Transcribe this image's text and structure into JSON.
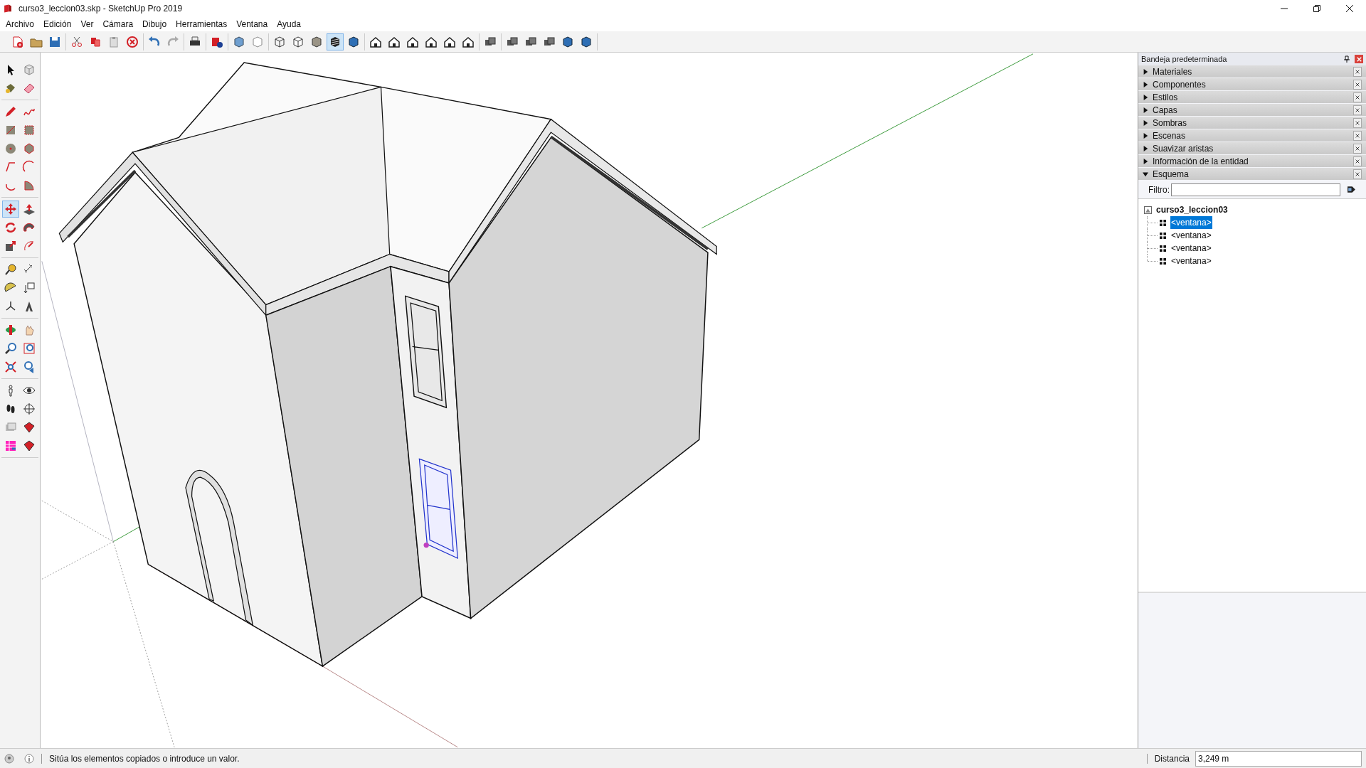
{
  "window": {
    "title": "curso3_leccion03.skp - SketchUp Pro 2019"
  },
  "menu": [
    "Archivo",
    "Edición",
    "Ver",
    "Cámara",
    "Dibujo",
    "Herramientas",
    "Ventana",
    "Ayuda"
  ],
  "toolbar": [
    [
      {
        "selected": false
      },
      {
        "selected": false
      },
      {
        "selected": false
      }
    ],
    [
      {
        "selected": false
      },
      {
        "selected": false
      },
      {
        "selected": false
      },
      {
        "selected": false
      }
    ],
    [
      {
        "selected": false
      },
      {
        "selected": false
      }
    ],
    [
      {
        "selected": false
      }
    ],
    [
      {
        "selected": false
      }
    ],
    [
      {
        "selected": false
      },
      {
        "selected": false
      }
    ],
    [
      {
        "selected": false
      },
      {
        "selected": false
      },
      {
        "selected": false
      },
      {
        "selected": true
      },
      {
        "selected": false
      }
    ],
    [
      {
        "selected": false
      },
      {
        "selected": false
      },
      {
        "selected": false
      },
      {
        "selected": false
      },
      {
        "selected": false
      },
      {
        "selected": false
      }
    ],
    [
      {
        "selected": false
      }
    ],
    [
      {
        "selected": false
      },
      {
        "selected": false
      },
      {
        "selected": false
      },
      {
        "selected": false
      },
      {
        "selected": false
      }
    ]
  ],
  "tool_palette": [
    [
      {
        "selected": false
      },
      {
        "selected": false
      },
      {
        "selected": false
      },
      {
        "selected": false
      }
    ],
    [
      {
        "selected": false
      },
      {
        "selected": false
      },
      {
        "selected": false
      },
      {
        "selected": false
      },
      {
        "selected": false
      },
      {
        "selected": false
      },
      {
        "selected": false
      },
      {
        "selected": false
      },
      {
        "selected": false
      },
      {
        "selected": false
      }
    ],
    [
      {
        "selected": true
      },
      {
        "selected": false
      },
      {
        "selected": false
      },
      {
        "selected": false
      },
      {
        "selected": false
      },
      {
        "selected": false
      }
    ],
    [
      {
        "selected": false
      },
      {
        "selected": false
      },
      {
        "selected": false
      },
      {
        "selected": false
      },
      {
        "selected": false
      },
      {
        "selected": false
      }
    ],
    [
      {
        "selected": false
      },
      {
        "selected": false
      },
      {
        "selected": false
      },
      {
        "selected": false
      },
      {
        "selected": false
      },
      {
        "selected": false
      }
    ],
    [
      {
        "selected": false
      },
      {
        "selected": false
      },
      {
        "selected": false
      },
      {
        "selected": false
      },
      {
        "selected": false
      },
      {
        "selected": false
      },
      {
        "selected": false
      },
      {
        "selected": false
      }
    ]
  ],
  "tray": {
    "title": "Bandeja predeterminada",
    "panels": [
      {
        "label": "Materiales",
        "expanded": false
      },
      {
        "label": "Componentes",
        "expanded": false
      },
      {
        "label": "Estilos",
        "expanded": false
      },
      {
        "label": "Capas",
        "expanded": false
      },
      {
        "label": "Sombras",
        "expanded": false
      },
      {
        "label": "Escenas",
        "expanded": false
      },
      {
        "label": "Suavizar aristas",
        "expanded": false
      },
      {
        "label": "Información de la entidad",
        "expanded": false
      },
      {
        "label": "Esquema",
        "expanded": true
      }
    ],
    "outliner": {
      "filter_label": "Filtro:",
      "model": {
        "label": "curso3_leccion03",
        "children": [
          {
            "label": "<ventana>",
            "selected": true
          },
          {
            "label": "<ventana>",
            "selected": false
          },
          {
            "label": "<ventana>",
            "selected": false
          },
          {
            "label": "<ventana>",
            "selected": false
          }
        ]
      }
    }
  },
  "status_bar": {
    "message": "Sitúa los elementos copiados o introduce un valor.",
    "measure_label": "Distancia",
    "measure_value": "3,249 m"
  }
}
